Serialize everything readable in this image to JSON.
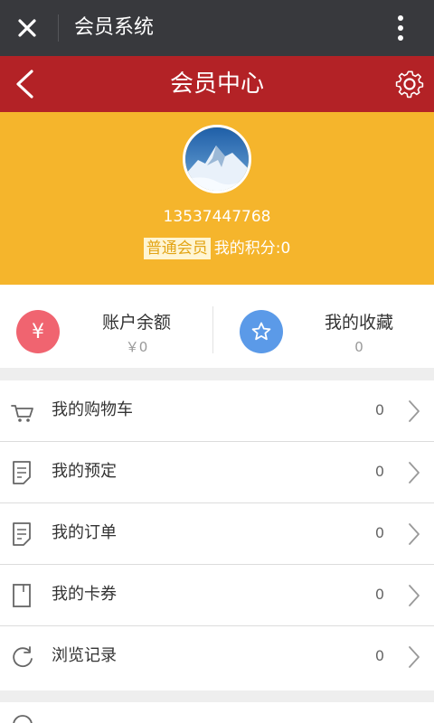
{
  "wechat_bar": {
    "title": "会员系统"
  },
  "nav": {
    "title": "会员中心"
  },
  "profile": {
    "phone": "13537447768",
    "level": "普通会员",
    "points_text": "我的积分:0"
  },
  "summary": {
    "balance": {
      "icon_glyph": "¥",
      "label": "账户余额",
      "value": "￥0",
      "color": "#f06470"
    },
    "favorites": {
      "label": "我的收藏",
      "value": "0",
      "color": "#5b9ae8"
    }
  },
  "menu": {
    "items": [
      {
        "label": "我的购物车",
        "count": "0",
        "icon": "cart-icon"
      },
      {
        "label": "我的预定",
        "count": "0",
        "icon": "document-icon"
      },
      {
        "label": "我的订单",
        "count": "0",
        "icon": "document-icon"
      },
      {
        "label": "我的卡券",
        "count": "0",
        "icon": "card-icon"
      },
      {
        "label": "浏览记录",
        "count": "0",
        "icon": "refresh-icon"
      }
    ]
  },
  "colors": {
    "wechat_bar": "#38393d",
    "nav_bar": "#b32226",
    "profile_bg": "#f5b52c"
  }
}
